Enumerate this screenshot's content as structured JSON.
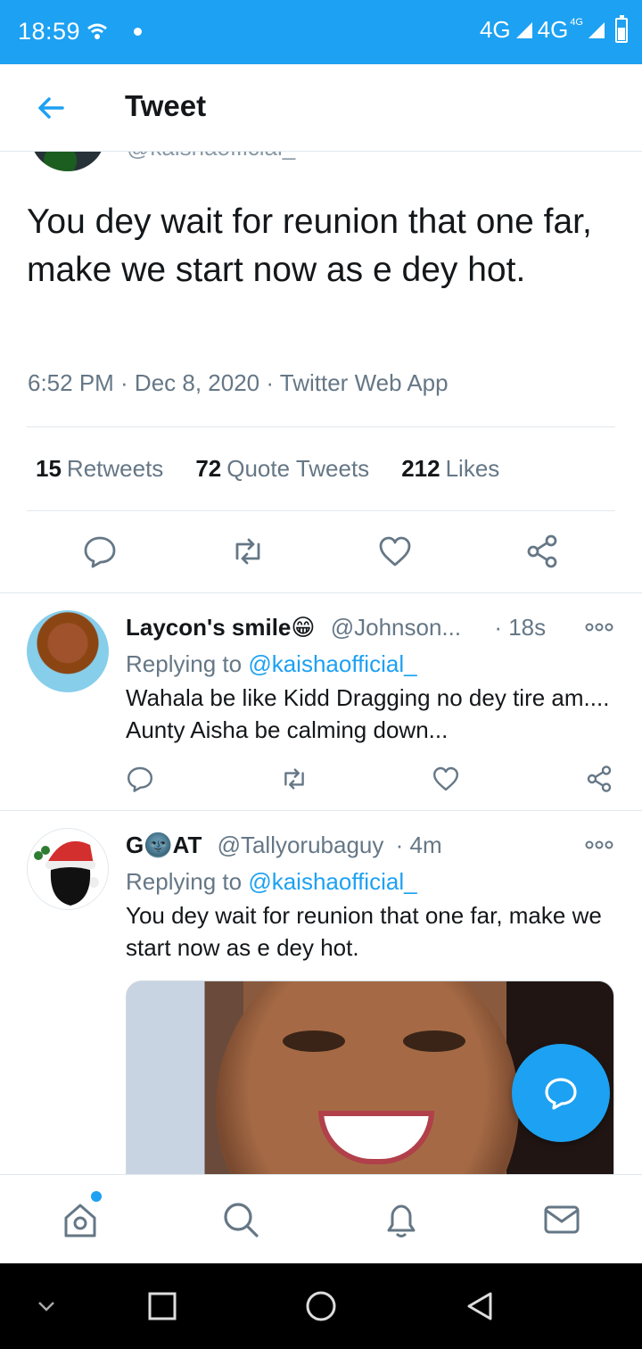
{
  "status_bar": {
    "time": "18:59",
    "network1": "4G",
    "network2": "4G",
    "network2_sup": "4G"
  },
  "header": {
    "title": "Tweet"
  },
  "tweet": {
    "hidden_handle": "@kaishaofficial_",
    "text": "You dey wait for reunion that one far, make we start now as e dey hot.",
    "meta": "6:52 PM · Dec 8, 2020 · Twitter Web App",
    "stats": {
      "retweets_count": "15",
      "retweets_label": "Retweets",
      "quotes_count": "72",
      "quotes_label": "Quote Tweets",
      "likes_count": "212",
      "likes_label": "Likes"
    }
  },
  "replies": [
    {
      "name": "Laycon's smile😁",
      "handle": "@Johnson...",
      "time": "· 18s",
      "replying_prefix": "Replying to ",
      "replying_to": "@kaishaofficial_",
      "text": "Wahala be like Kidd Dragging no dey tire am.... Aunty Aisha be calming down..."
    },
    {
      "name": "G🌚AT",
      "handle": "@Tallyorubaguy",
      "time": "· 4m",
      "replying_prefix": "Replying to ",
      "replying_to": "@kaishaofficial_",
      "text": "You dey wait for reunion that one far, make we start now as e dey hot."
    }
  ],
  "colors": {
    "accent": "#1da1f2",
    "text": "#14171a",
    "secondary": "#657786",
    "divider": "#e1e8ed"
  },
  "icons": {
    "actions": [
      "reply-icon",
      "retweet-icon",
      "like-icon",
      "share-icon"
    ],
    "bottom_nav": [
      "home-icon",
      "search-icon",
      "notifications-icon",
      "messages-icon"
    ],
    "system_nav": [
      "chevron-down-icon",
      "recents-icon",
      "home-circle-icon",
      "back-triangle-icon"
    ]
  }
}
